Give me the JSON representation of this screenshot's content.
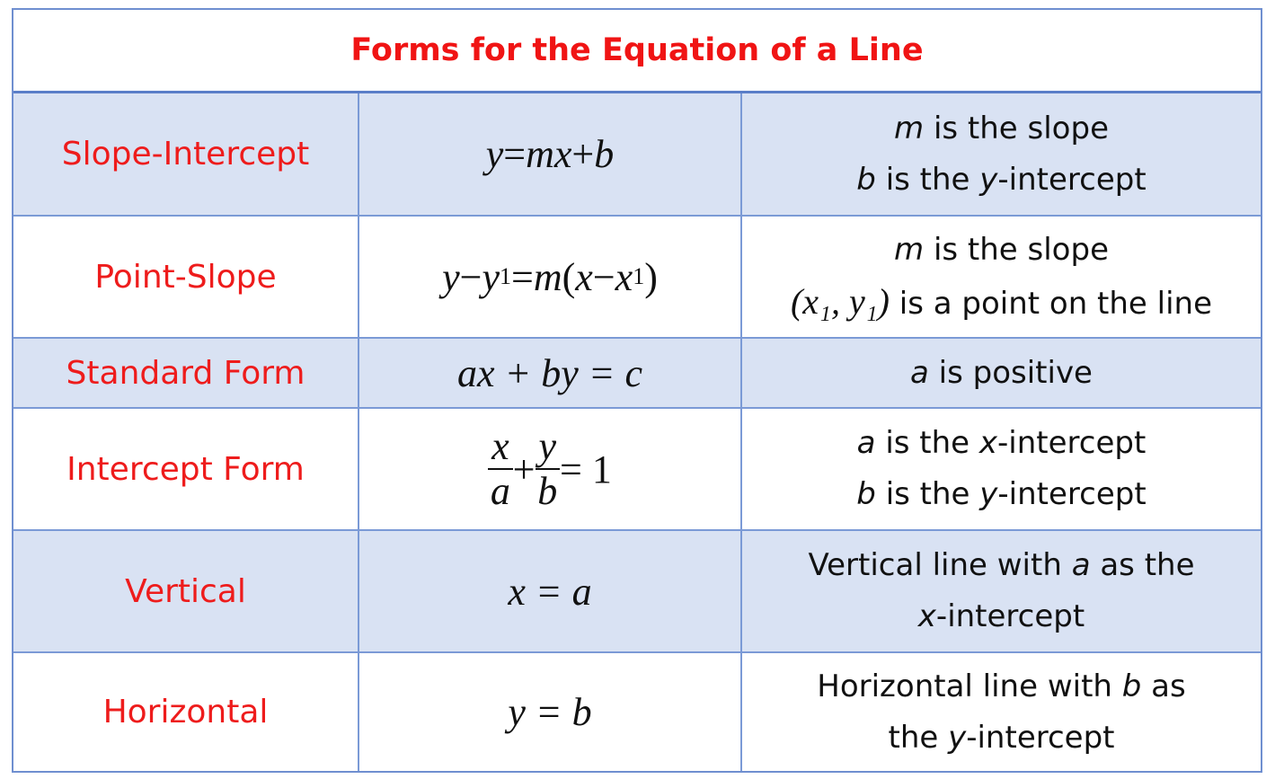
{
  "title": "Forms for the Equation of a Line",
  "rows": [
    {
      "name": "Slope-Intercept",
      "shaded": true,
      "eq": {
        "y": "y",
        "eqs": " = ",
        "m": "m",
        "x": "x",
        "plus": " + ",
        "b": "b"
      },
      "desc": [
        {
          "v": "m",
          "t": " is the slope"
        },
        {
          "v": "b",
          "t": " is the ",
          "v2": "y",
          "t2": "-intercept"
        }
      ]
    },
    {
      "name": "Point-Slope",
      "shaded": false,
      "eq": {
        "y": "y",
        "minus": " − ",
        "y1": "y",
        "one": "1",
        "eqs": " = ",
        "m": "m",
        "lp": "(",
        "x": "x",
        "x1": "x",
        "rp": ")"
      },
      "desc": [
        {
          "v": "m",
          "t": " is the slope"
        },
        {
          "pt": "(x₁, y₁)",
          "t": " is a point on the line"
        }
      ]
    },
    {
      "name": "Standard Form",
      "shaded": true,
      "eq": {
        "text": "ax + by = c"
      },
      "desc": [
        {
          "v": "a",
          "t": " is positive"
        }
      ]
    },
    {
      "name": "Intercept Form",
      "shaded": false,
      "eq": {
        "n1": "x",
        "d1": "a",
        "plus": " + ",
        "n2": "y",
        "d2": "b",
        "rhs": " = 1"
      },
      "desc": [
        {
          "v": "a",
          "t": " is the ",
          "v2": "x",
          "t2": "-intercept"
        },
        {
          "v": "b",
          "t": " is the ",
          "v2": "y",
          "t2": "-intercept"
        }
      ]
    },
    {
      "name": "Vertical",
      "shaded": true,
      "eq": {
        "text": "x = a"
      },
      "desc": [
        {
          "t": "Vertical line with ",
          "v": "a",
          "t2": " as the"
        },
        {
          "v": "x",
          "t": "-intercept"
        }
      ]
    },
    {
      "name": "Horizontal",
      "shaded": false,
      "eq": {
        "text": "y = b"
      },
      "desc": [
        {
          "t": "Horizontal line with ",
          "v": "b",
          "t2": " as"
        },
        {
          "t": "the ",
          "v": "y",
          "t2": "-intercept"
        }
      ]
    }
  ]
}
